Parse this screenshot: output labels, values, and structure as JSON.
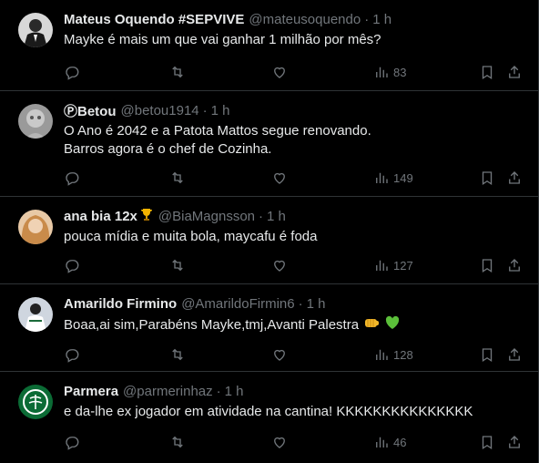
{
  "tweets": [
    {
      "name": "Mateus Oquendo #SEPVIVE",
      "handle": "@mateusoquendo",
      "sep": "·",
      "time": "1 h",
      "lines": [
        "Mayke é mais um que vai ganhar 1 milhão por mês?"
      ],
      "views": "83",
      "avatar_icon": "person-suit-avatar"
    },
    {
      "name": "ⓅBetou",
      "handle": "@betou1914",
      "sep": "·",
      "time": "1 h",
      "lines": [
        "O Ano é 2042 e a Patota Mattos segue renovando.",
        "Barros agora é o chef de Cozinha."
      ],
      "views": "149",
      "avatar_icon": "statue-avatar"
    },
    {
      "name": "ana bia 12x",
      "handle": "@BiaMagnsson",
      "sep": "·",
      "time": "1 h",
      "lines": [
        "pouca mídia e muita bola, maycafu é foda"
      ],
      "views": "127",
      "avatar_icon": "woman-avatar",
      "name_emoji": "trophy"
    },
    {
      "name": "Amarildo Firmino",
      "handle": "@AmarildoFirmin6",
      "sep": "·",
      "time": "1 h",
      "lines": [
        "Boaa,ai sim,Parabéns Mayke,tmj,Avanti Palestra"
      ],
      "views": "128",
      "avatar_icon": "player-avatar",
      "text_emojis": [
        "fist",
        "green-heart"
      ]
    },
    {
      "name": "Parmera",
      "handle": "@parmerinhaz",
      "sep": "·",
      "time": "1 h",
      "lines": [
        "e da-lhe ex jogador em atividade na cantina! KKKKKKKKKKKKKKK"
      ],
      "views": "46",
      "avatar_icon": "palmeiras-crest-avatar"
    }
  ],
  "colors": {
    "background": "#000000",
    "text": "#e7e9ea",
    "muted": "#71767b",
    "border": "#2f3336"
  }
}
